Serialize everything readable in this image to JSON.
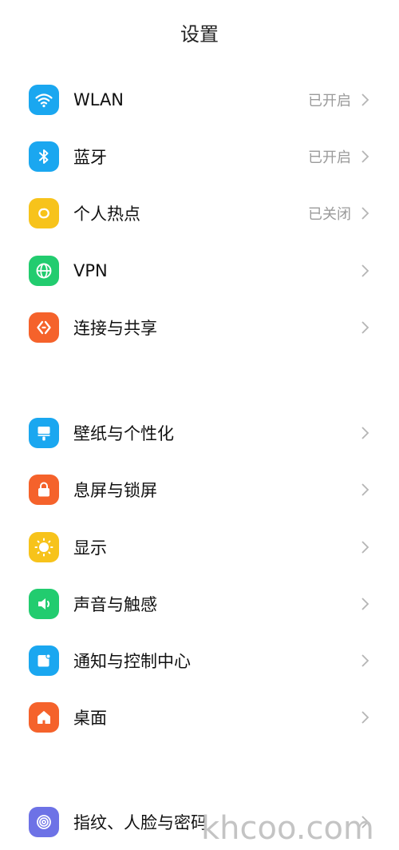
{
  "header": {
    "title": "设置"
  },
  "sections": [
    {
      "items": [
        {
          "name": "wlan",
          "label": "WLAN",
          "value": "已开启",
          "icon": "wifi-icon",
          "color": "#1aa7f0"
        },
        {
          "name": "bluetooth",
          "label": "蓝牙",
          "value": "已开启",
          "icon": "bluetooth-icon",
          "color": "#1aa7f0"
        },
        {
          "name": "hotspot",
          "label": "个人热点",
          "value": "已关闭",
          "icon": "hotspot-icon",
          "color": "#f7c31b"
        },
        {
          "name": "vpn",
          "label": "VPN",
          "value": "",
          "icon": "globe-icon",
          "color": "#22cc6f"
        },
        {
          "name": "connection-sharing",
          "label": "连接与共享",
          "value": "",
          "icon": "share-icon",
          "color": "#f5622b"
        }
      ]
    },
    {
      "items": [
        {
          "name": "wallpaper",
          "label": "壁纸与个性化",
          "value": "",
          "icon": "brush-icon",
          "color": "#1aa7f0"
        },
        {
          "name": "lock-screen",
          "label": "息屏与锁屏",
          "value": "",
          "icon": "lock-icon",
          "color": "#f5622b"
        },
        {
          "name": "display",
          "label": "显示",
          "value": "",
          "icon": "sun-icon",
          "color": "#f7c31b"
        },
        {
          "name": "sound",
          "label": "声音与触感",
          "value": "",
          "icon": "speaker-icon",
          "color": "#22cc6f"
        },
        {
          "name": "notifications",
          "label": "通知与控制中心",
          "value": "",
          "icon": "notification-icon",
          "color": "#1aa7f0"
        },
        {
          "name": "home-screen",
          "label": "桌面",
          "value": "",
          "icon": "home-icon",
          "color": "#f5622b"
        }
      ]
    },
    {
      "items": [
        {
          "name": "fingerprint",
          "label": "指纹、人脸与密码",
          "value": "",
          "icon": "fingerprint-icon",
          "color": "#6d72e6"
        }
      ]
    }
  ],
  "watermark": "khcoo.com"
}
